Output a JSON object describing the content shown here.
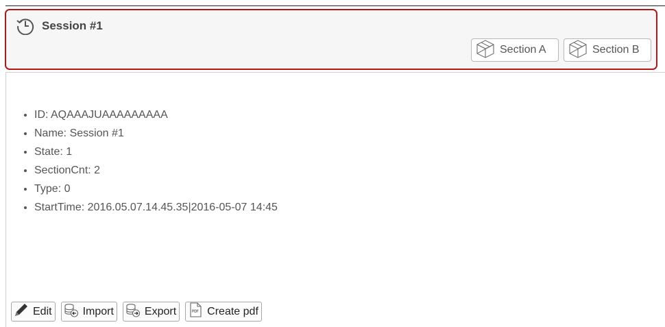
{
  "header": {
    "title": "Session #1",
    "icon": "history-clock-icon",
    "accent_color": "#b01818",
    "section_buttons": [
      {
        "label": "Section A",
        "icon": "cube-icon"
      },
      {
        "label": "Section B",
        "icon": "cube-icon"
      }
    ]
  },
  "details": {
    "id": "ID: AQAAAJUAAAAAAAAA",
    "name": "Name: Session #1",
    "state": "State: 1",
    "section_count": "SectionCnt: 2",
    "type": "Type: 0",
    "start_time": "StartTime: 2016.05.07.14.45.35|2016-05-07 14:45"
  },
  "actions": {
    "edit": "Edit",
    "import": "Import",
    "export": "Export",
    "create_pdf": "Create pdf"
  }
}
